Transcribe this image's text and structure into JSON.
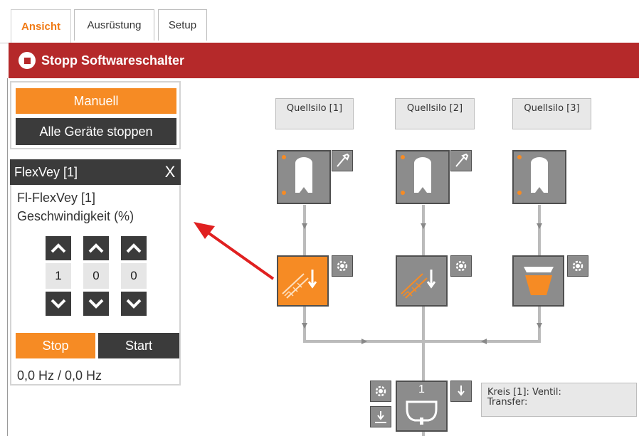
{
  "tabs": [
    {
      "label": "Ansicht",
      "active": true
    },
    {
      "label": "Ausrüstung",
      "active": false
    },
    {
      "label": "Setup",
      "active": false
    }
  ],
  "status_bar": {
    "title": "Stopp Softwareschalter",
    "color": "#b5292a"
  },
  "mode": {
    "manual_label": "Manuell",
    "stop_all_label": "Alle Geräte stoppen"
  },
  "panel": {
    "title": "FlexVey [1]",
    "close_label": "X",
    "device_name": "Fl-FlexVey [1]",
    "param_label": "Geschwindigkeit (%)",
    "digits": [
      "1",
      "0",
      "0"
    ],
    "stop_label": "Stop",
    "start_label": "Start",
    "frequency": "0,0 Hz / 0,0 Hz"
  },
  "diagram": {
    "silos": [
      {
        "label": "Quellsilo [1]"
      },
      {
        "label": "Quellsilo [2]"
      },
      {
        "label": "Quellsilo [3]"
      }
    ],
    "receiver": {
      "number": "1"
    },
    "info": {
      "line1": "Kreis [1]: Ventil:",
      "line2": "Transfer:"
    }
  },
  "colors": {
    "accent": "#f68b24",
    "dark": "#3b3b3b",
    "alert": "#b5292a",
    "pointer_arrow": "#e02020"
  },
  "icons": [
    "stop-icon",
    "silo-icon",
    "wrench-icon",
    "flexvey-conveyor-icon",
    "gear-icon",
    "hopper-icon",
    "down-arrow-icon",
    "receiver-icon",
    "chevron-up-icon",
    "chevron-down-icon"
  ]
}
